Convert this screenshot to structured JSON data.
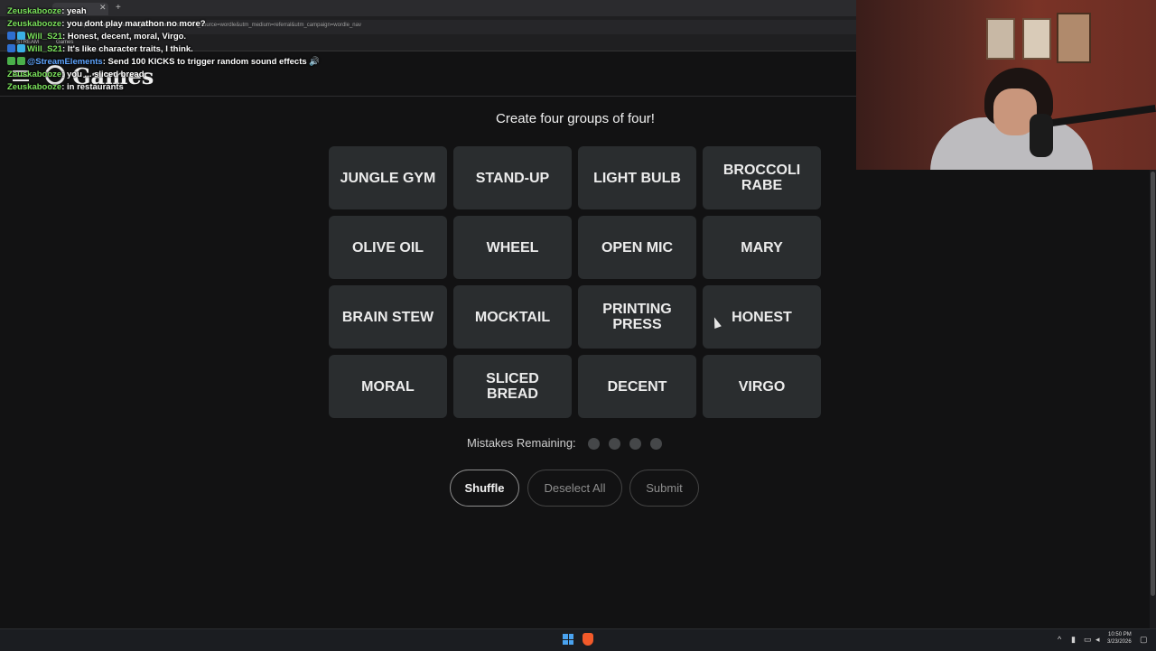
{
  "browser": {
    "url": "https://www.nytimes.com/games/connections?utm_source=wordle&utm_medium=referral&utm_campaign=wordle_nav",
    "bookmarks": [
      "STREAM",
      "Games"
    ]
  },
  "chat": [
    {
      "user": "Zeuskabooze",
      "message": ": yeah",
      "user_color": "#7be35c"
    },
    {
      "user": "Zeuskabooze",
      "message": ": you dont play marathon no more?",
      "user_color": "#7be35c"
    },
    {
      "user": "Will_S21",
      "message": ": Honest, decent, moral, Virgo.",
      "user_color": "#7be35c"
    },
    {
      "user": "Will_S21",
      "message": ": It's like character traits, I think.",
      "user_color": "#7be35c"
    },
    {
      "user": "@StreamElements",
      "message": ": Send 100 KICKS to trigger random sound effects",
      "user_color": "#5fa5ff"
    },
    {
      "user": "Zeuskabooze",
      "message": ": you ... sliced bread",
      "user_color": "#7be35c"
    },
    {
      "user": "Zeuskabooze",
      "message": ": in restaurants",
      "user_color": "#7be35c"
    }
  ],
  "header": {
    "logo_text": "Games"
  },
  "game": {
    "prompt": "Create four groups of four!",
    "tiles": [
      [
        "JUNGLE GYM",
        "STAND-UP",
        "LIGHT BULB",
        "BROCCOLI RABE"
      ],
      [
        "OLIVE OIL",
        "WHEEL",
        "OPEN MIC",
        "MARY"
      ],
      [
        "BRAIN STEW",
        "MOCKTAIL",
        "PRINTING PRESS",
        "HONEST"
      ],
      [
        "MORAL",
        "SLICED BREAD",
        "DECENT",
        "VIRGO"
      ]
    ],
    "mistakes_label": "Mistakes Remaining:",
    "mistakes_remaining": 4,
    "buttons": {
      "shuffle": "Shuffle",
      "deselect": "Deselect All",
      "submit": "Submit"
    }
  },
  "taskbar": {
    "time": "10:50 PM",
    "date": "3/23/2026"
  },
  "colors": {
    "background": "#121213",
    "tile": "#2a2d2f",
    "chat_user": "#7be35c",
    "mention_user": "#5fa5ff"
  }
}
